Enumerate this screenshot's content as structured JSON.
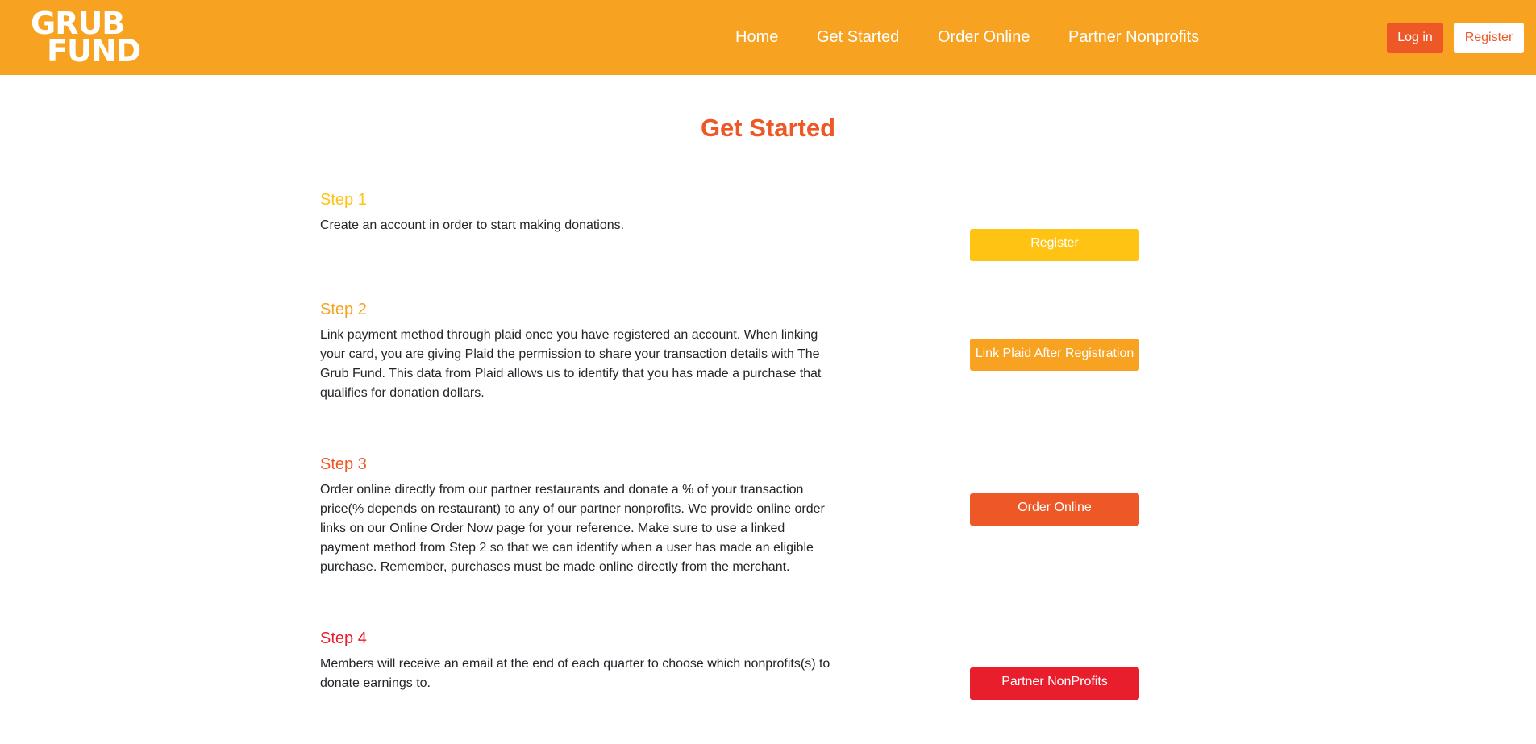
{
  "header": {
    "logo_line1": "GRUB",
    "logo_line2": "FUND",
    "nav": [
      {
        "label": "Home"
      },
      {
        "label": "Get Started"
      },
      {
        "label": "Order Online"
      },
      {
        "label": "Partner Nonprofits"
      }
    ],
    "login_label": "Log in",
    "register_label": "Register"
  },
  "main": {
    "title": "Get Started",
    "steps": [
      {
        "title": "Step 1",
        "description": "Create an account in order to start making donations.",
        "button_label": "Register",
        "color": "#fec313"
      },
      {
        "title": "Step 2",
        "description": "Link payment method through plaid once you have registered an account. When linking your card, you are giving Plaid the permission to share your transaction details with The Grub Fund. This data from Plaid allows us to identify that you has made a purchase that qualifies for donation dollars.",
        "button_label": "Link Plaid After Registration",
        "color": "#f7a221"
      },
      {
        "title": "Step 3",
        "description": "Order online directly from our partner restaurants and donate a % of your transaction price(% depends on restaurant) to any of our partner nonprofits. We provide online order links on our Online Order Now page for your reference. Make sure to use a linked payment method from Step 2 so that we can identify when a user has made an eligible purchase. Remember, purchases must be made online directly from the merchant.",
        "button_label": "Order Online",
        "color": "#ee5827"
      },
      {
        "title": "Step 4",
        "description": "Members will receive an email at the end of each quarter to choose which nonprofits(s) to donate earnings to.",
        "button_label": "Partner NonProfits",
        "color": "#e81e2c"
      }
    ]
  },
  "colors": {
    "header_bg": "#f7a221",
    "accent": "#ee5827"
  }
}
